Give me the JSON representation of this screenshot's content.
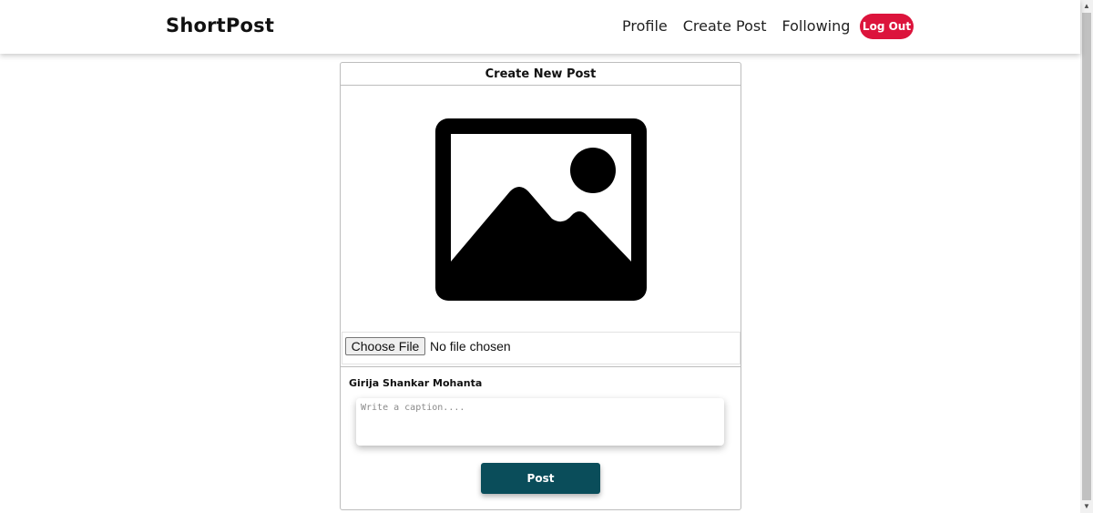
{
  "navbar": {
    "brand": "ShortPost",
    "links": [
      {
        "label": "Profile"
      },
      {
        "label": "Create Post"
      },
      {
        "label": "Following"
      }
    ],
    "logout_label": "Log Out"
  },
  "create_post": {
    "title": "Create New Post",
    "image_placeholder_icon": "image-icon",
    "choose_file_label": "Choose File",
    "file_status": "No file chosen",
    "username": "Girija Shankar Mohanta",
    "caption_placeholder": "Write a caption....",
    "caption_value": "",
    "post_label": "Post"
  },
  "colors": {
    "logout_bg": "#dc143c",
    "post_bg": "#0a4d5a",
    "card_border": "#bdbdbd"
  }
}
